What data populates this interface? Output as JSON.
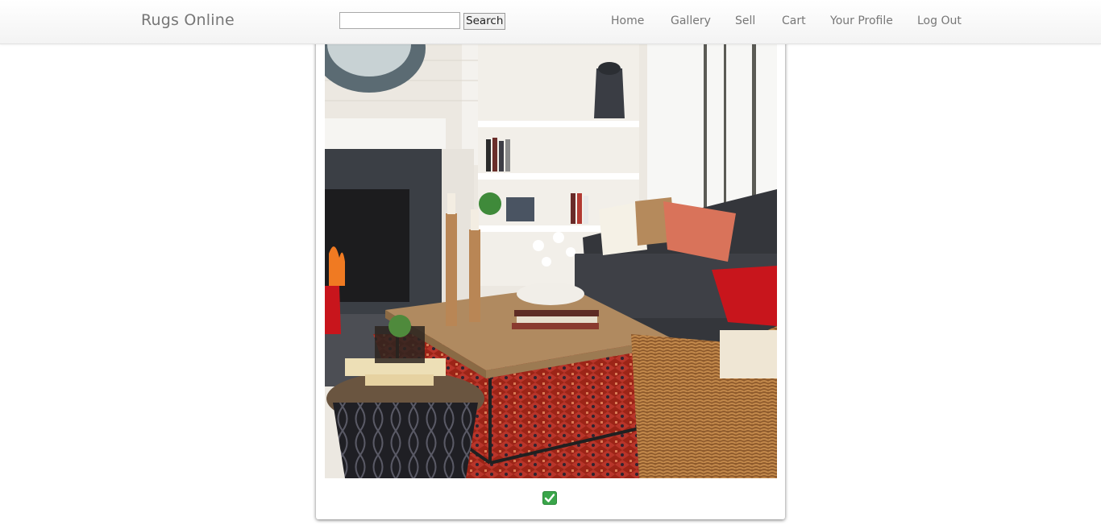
{
  "header": {
    "brand": "Rugs Online",
    "search": {
      "value": "",
      "placeholder": "",
      "button_label": "Search"
    },
    "nav": [
      {
        "label": "Home"
      },
      {
        "label": "Gallery"
      },
      {
        "label": "Sell"
      },
      {
        "label": "Cart"
      },
      {
        "label": "Your Profile"
      },
      {
        "label": "Log Out"
      }
    ]
  },
  "main": {
    "image": {
      "alt": "living room with red patterned rug",
      "description_icon": "living-room-photo"
    },
    "status_icon": "check-mark-icon"
  },
  "colors": {
    "nav_text": "#777777",
    "status_green": "#3aa64a",
    "rug_red": "#a82a1e"
  }
}
